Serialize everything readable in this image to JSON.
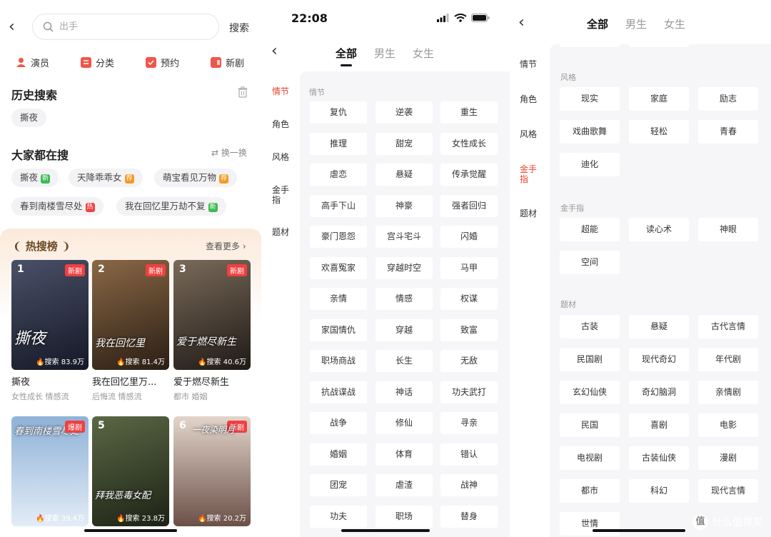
{
  "panel1": {
    "search": {
      "placeholder": "出手",
      "button": "搜索"
    },
    "quick_links": [
      {
        "label": "演员",
        "color": "#f0564a"
      },
      {
        "label": "分类",
        "color": "#f0564a"
      },
      {
        "label": "预约",
        "color": "#f0564a"
      },
      {
        "label": "新剧",
        "color": "#f0564a"
      }
    ],
    "history": {
      "title": "历史搜索",
      "items": [
        "撕夜"
      ]
    },
    "trending": {
      "title": "大家都在搜",
      "refresh": "换一换",
      "items": [
        {
          "label": "撕夜",
          "badge": "新",
          "badge_color": "#3cba54"
        },
        {
          "label": "天降乖乖女",
          "badge": "荐",
          "badge_color": "#f59a23"
        },
        {
          "label": "萌宝看见万物",
          "badge": "荐",
          "badge_color": "#f59a23"
        },
        {
          "label": "春到南楼雪尽处",
          "badge": "热",
          "badge_color": "#f04040"
        },
        {
          "label": "我在回忆里万劫不复",
          "badge": "新",
          "badge_color": "#3cba54"
        }
      ]
    },
    "hot": {
      "title": "热搜榜",
      "more": "查看更多",
      "cards": [
        {
          "rank": "1",
          "tag": "新剧",
          "heat": "搜索 83.9万",
          "poster_text": "撕夜",
          "name": "撕夜",
          "tags": "女性成长 情感流",
          "color1": "#3a3f52",
          "color2": "#131722"
        },
        {
          "rank": "2",
          "tag": "新剧",
          "heat": "搜索 81.4万",
          "poster_text": "我在回忆里",
          "name": "我在回忆里万...",
          "tags": "后悔流 情感流",
          "color1": "#7a5a3c",
          "color2": "#2a1e14"
        },
        {
          "rank": "3",
          "tag": "新剧",
          "heat": "搜索 40.6万",
          "poster_text": "爱于燃尽新生",
          "name": "爱于燃尽新生",
          "tags": "都市 婚姻",
          "color1": "#6b5a4a",
          "color2": "#1f1a16"
        },
        {
          "rank": "4",
          "tag": "爆剧",
          "heat": "搜索 39.4万",
          "poster_text": "春到南楼雪尽处",
          "name": "",
          "tags": "",
          "color1": "#8fb2d8",
          "color2": "#dfe9f4"
        },
        {
          "rank": "5",
          "tag": "",
          "heat": "搜索 23.8万",
          "poster_text": "拜我恶毒女配",
          "name": "",
          "tags": "",
          "color1": "#4d5a3a",
          "color2": "#1d2216"
        },
        {
          "rank": "6",
          "tag": "新剧",
          "heat": "搜索 20.2万",
          "poster_text": "一夜染明月",
          "name": "",
          "tags": "",
          "color1": "#d9c8bd",
          "color2": "#6b5048"
        }
      ]
    }
  },
  "panel2": {
    "time": "22:08",
    "tabs": [
      "全部",
      "男生",
      "女生"
    ],
    "sidebar": [
      "情节",
      "角色",
      "风格",
      "金手指",
      "题材"
    ],
    "group_title": "情节",
    "pills": [
      "复仇",
      "逆袭",
      "重生",
      "推理",
      "甜宠",
      "女性成长",
      "虐恋",
      "悬疑",
      "传承觉醒",
      "高手下山",
      "神豪",
      "强者回归",
      "豪门恩怨",
      "宫斗宅斗",
      "闪婚",
      "欢喜冤家",
      "穿越时空",
      "马甲",
      "亲情",
      "情感",
      "权谋",
      "家国情仇",
      "穿越",
      "致富",
      "职场商战",
      "长生",
      "无敌",
      "抗战谍战",
      "神话",
      "功夫武打",
      "战争",
      "修仙",
      "寻亲",
      "婚姻",
      "体育",
      "错认",
      "团宠",
      "虐渣",
      "战神",
      "功夫",
      "职场",
      "替身"
    ]
  },
  "panel3": {
    "tabs": [
      "全部",
      "男生",
      "女生"
    ],
    "sidebar": [
      "情节",
      "角色",
      "风格",
      "金手指",
      "题材"
    ],
    "groups": [
      {
        "title": "风格",
        "items": [
          "现实",
          "家庭",
          "励志",
          "戏曲歌舞",
          "轻松",
          "青春",
          "迪化"
        ]
      },
      {
        "title": "金手指",
        "items": [
          "超能",
          "读心术",
          "神眼",
          "空间"
        ]
      },
      {
        "title": "题材",
        "items": [
          "古装",
          "悬疑",
          "古代言情",
          "民国剧",
          "现代奇幻",
          "年代剧",
          "玄幻仙侠",
          "奇幻脑洞",
          "亲情剧",
          "民国",
          "喜剧",
          "电影",
          "电视剧",
          "古装仙侠",
          "漫剧",
          "都市",
          "科幻",
          "现代言情",
          "世情"
        ]
      }
    ],
    "watermark": {
      "icon": "值",
      "text": "什么值得买"
    }
  }
}
